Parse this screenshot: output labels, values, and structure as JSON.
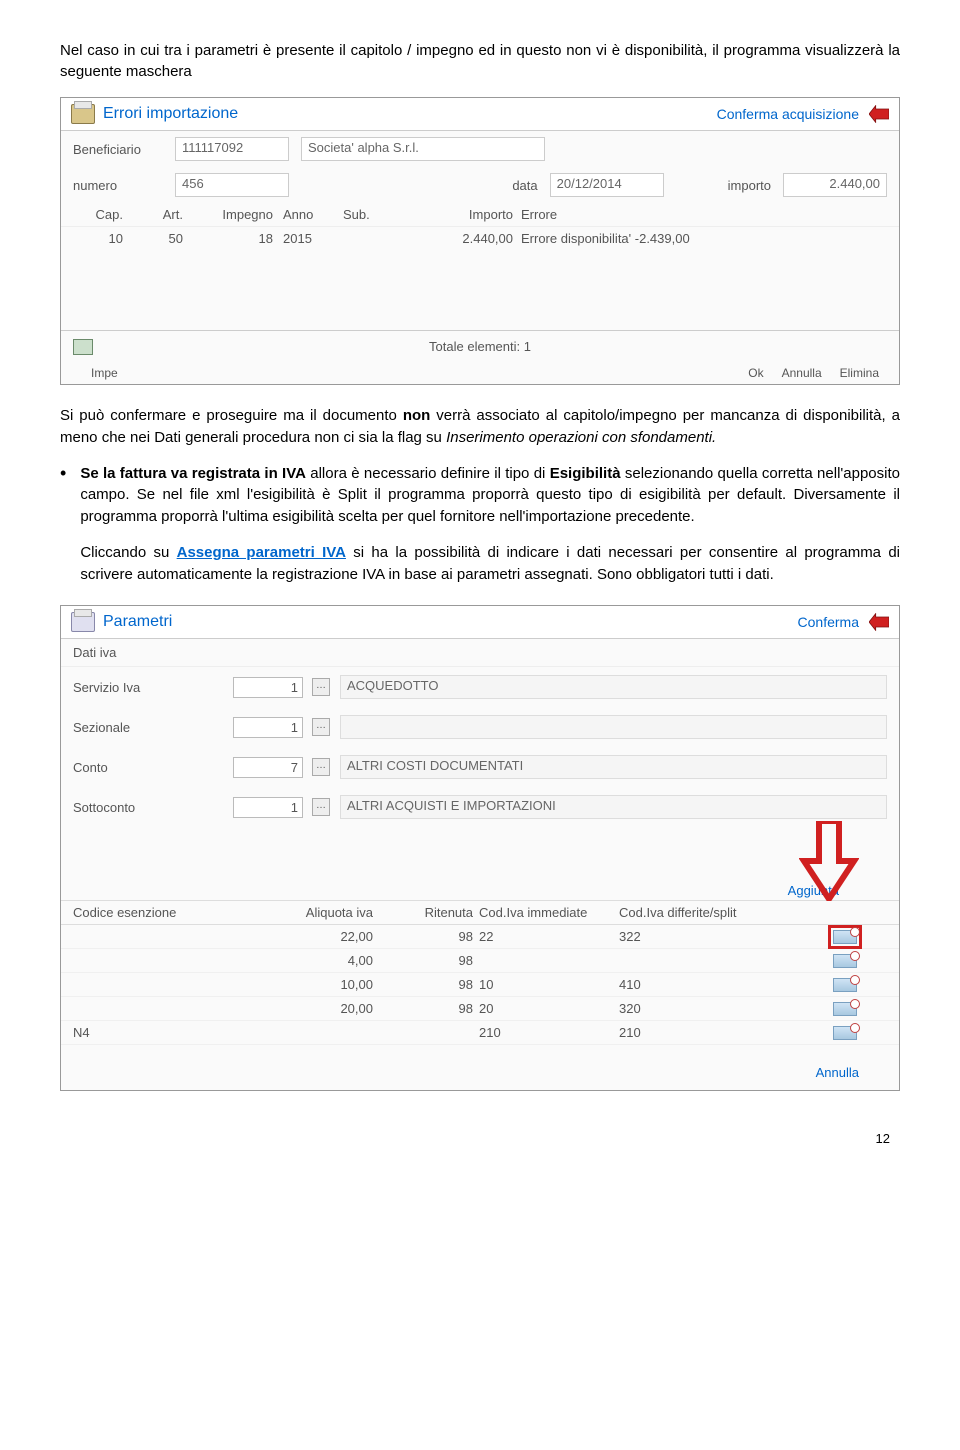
{
  "intro": "Nel caso in cui tra i parametri è presente il capitolo / impegno ed in questo non vi è disponibilità, il programma visualizzerà la seguente maschera",
  "win1": {
    "title": "Errori importazione",
    "confirm": "Conferma acquisizione",
    "beneficiario_lbl": "Beneficiario",
    "beneficiario_code": "111117092",
    "beneficiario_name": "Societa' alpha S.r.l.",
    "numero_lbl": "numero",
    "numero_val": "456",
    "data_lbl": "data",
    "data_val": "20/12/2014",
    "importo_lbl": "importo",
    "importo_val": "2.440,00",
    "headers": {
      "cap": "Cap.",
      "art": "Art.",
      "impegno": "Impegno",
      "anno": "Anno",
      "sub": "Sub.",
      "importo": "Importo",
      "errore": "Errore"
    },
    "row": {
      "cap": "10",
      "art": "50",
      "impegno": "18",
      "anno": "2015",
      "sub": "",
      "importo": "2.440,00",
      "errore": "Errore disponibilita' -2.439,00"
    },
    "totale": "Totale elementi: 1",
    "footer_labels": {
      "impe": "Impe",
      "ok": "Ok",
      "annulla": "Annulla",
      "elimina": "Elimina"
    }
  },
  "para1_a": "Si può confermare e proseguire ma il documento ",
  "para1_b": "non",
  "para1_c": " verrà associato al capitolo/impegno per mancanza di disponibilità, a meno che nei Dati generali procedura non ci sia la flag su ",
  "para1_d": "Inserimento operazioni con sfondamenti.",
  "bullet_a": "Se la fattura va registrata in IVA",
  "bullet_b": " allora è necessario definire il tipo di ",
  "bullet_c": "Esigibilità",
  "bullet_d": " selezionando quella corretta nell'apposito campo. Se nel file xml l'esigibilità è Split il programma proporrà questo tipo di esigibilità per default. Diversamente il programma proporrà l'ultima esigibilità scelta per quel fornitore nell'importazione precedente.",
  "para2_a": "Cliccando su ",
  "para2_link": "Assegna parametri IVA",
  "para2_b": " si ha la possibilità di indicare i dati necessari per consentire al programma di scrivere automaticamente la registrazione IVA in base ai parametri assegnati. Sono obbligatori tutti i dati.",
  "win2": {
    "title": "Parametri",
    "confirm": "Conferma",
    "section": "Dati iva",
    "rows": [
      {
        "label": "Servizio Iva",
        "code": "1",
        "desc": "ACQUEDOTTO"
      },
      {
        "label": "Sezionale",
        "code": "1",
        "desc": ""
      },
      {
        "label": "Conto",
        "code": "7",
        "desc": "ALTRI COSTI DOCUMENTATI"
      },
      {
        "label": "Sottoconto",
        "code": "1",
        "desc": "ALTRI ACQUISTI E IMPORTAZIONI"
      }
    ],
    "aggiunta": "Aggiunta",
    "iva_headers": {
      "c1": "Codice esenzione",
      "c2": "Aliquota iva",
      "c3": "Ritenuta",
      "c4": "Cod.Iva immediate",
      "c5": "Cod.Iva differite/split"
    },
    "iva_rows": [
      {
        "c1": "",
        "c2": "22,00",
        "c3": "98",
        "c4": "22",
        "c5": "322",
        "hl": true
      },
      {
        "c1": "",
        "c2": "4,00",
        "c3": "98",
        "c4": "",
        "c5": "",
        "hl": false
      },
      {
        "c1": "",
        "c2": "10,00",
        "c3": "98",
        "c4": "10",
        "c5": "410",
        "hl": false
      },
      {
        "c1": "",
        "c2": "20,00",
        "c3": "98",
        "c4": "20",
        "c5": "320",
        "hl": false
      },
      {
        "c1": "N4",
        "c2": "",
        "c3": "",
        "c4": "210",
        "c5": "210",
        "hl": false
      }
    ],
    "annulla": "Annulla"
  },
  "page": "12"
}
